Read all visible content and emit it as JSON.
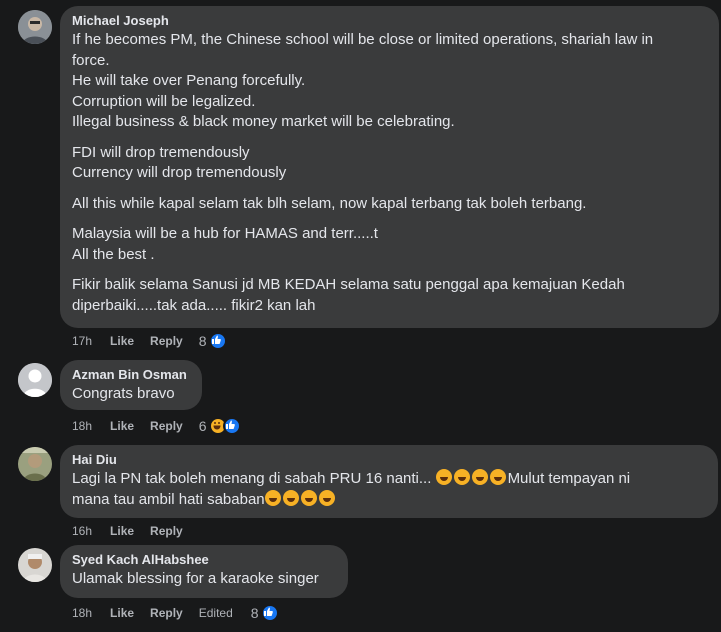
{
  "comments": [
    {
      "author": "Michael Joseph",
      "lines": [
        "If he becomes PM, the Chinese school will be close or limited operations, shariah law in",
        "force.",
        "He will take over Penang forcefully.",
        "Corruption will be legalized.",
        "Illegal business & black money market will be celebrating.",
        "",
        "FDI will drop tremendously",
        "Currency will drop tremendously",
        "",
        "All this while kapal selam tak blh selam, now kapal terbang tak boleh terbang.",
        "",
        "Malaysia will be a hub for HAMAS and terr.....t",
        "All the best .",
        "",
        "Fikir balik selama Sanusi jd MB KEDAH selama satu penggal apa kemajuan Kedah",
        "diperbaiki.....tak ada..... fikir2 kan lah"
      ],
      "time": "17h",
      "like": "Like",
      "reply": "Reply",
      "reaction_count": "8",
      "reactions": [
        "like-icon"
      ]
    },
    {
      "author": "Azman Bin Osman",
      "lines": [
        "Congrats bravo"
      ],
      "time": "18h",
      "like": "Like",
      "reply": "Reply",
      "reaction_count": "6",
      "reactions": [
        "haha-icon",
        "like-icon"
      ]
    },
    {
      "author": "Hai Diu",
      "line1": "Lagi la PN tak boleh menang di sabah PRU 16 nanti... ",
      "line1_emoji_count": 4,
      "line1_tail": "Mulut tempayan ni",
      "line2": "mana tau ambil hati sababan",
      "line2_emoji_count": 4,
      "time": "16h",
      "like": "Like",
      "reply": "Reply"
    },
    {
      "author": "Syed Kach AlHabshee",
      "lines": [
        "Ulamak blessing for a karaoke singer"
      ],
      "time": "18h",
      "like": "Like",
      "reply": "Reply",
      "edited": "Edited",
      "reaction_count": "8",
      "reactions": [
        "like-icon"
      ]
    }
  ],
  "colors": {
    "background": "#18191a",
    "bubble": "#3a3b3c",
    "text": "#e4e6eb",
    "muted": "#b0b3b8",
    "like_blue": "#1877f2",
    "haha_yellow": "#f7b125"
  }
}
